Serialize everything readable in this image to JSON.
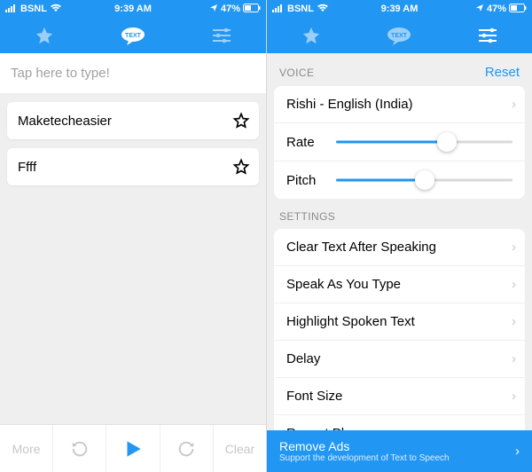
{
  "status": {
    "carrier": "BSNL",
    "time": "9:39 AM",
    "battery": "47%"
  },
  "nav": {
    "tab_text": "TEXT"
  },
  "left": {
    "placeholder": "Tap here to type!",
    "phrases": [
      "Maketecheasier",
      "Ffff"
    ],
    "toolbar": {
      "more": "More",
      "clear": "Clear"
    }
  },
  "right": {
    "voice_section": "VOICE",
    "reset": "Reset",
    "voice_name": "Rishi - English (India)",
    "rate_label": "Rate",
    "pitch_label": "Pitch",
    "rate_pct": 63,
    "pitch_pct": 50,
    "settings_section": "SETTINGS",
    "settings": [
      "Clear Text After Speaking",
      "Speak As You Type",
      "Highlight Spoken Text",
      "Delay",
      "Font Size",
      "Recent Phrases"
    ],
    "remove_ads_title": "Remove Ads",
    "remove_ads_sub": "Support the development of Text to Speech"
  }
}
